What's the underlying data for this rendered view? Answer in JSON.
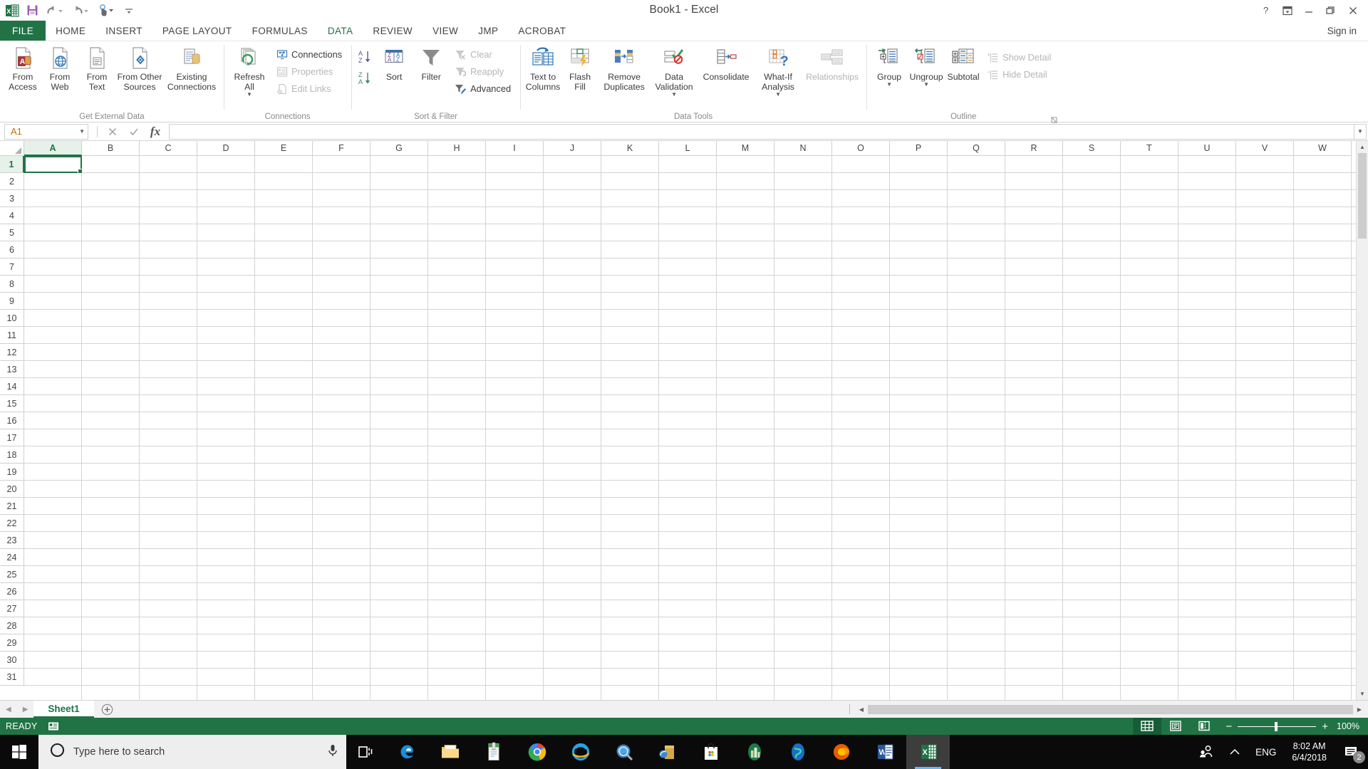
{
  "window": {
    "title": "Book1 - Excel",
    "help_label": "?",
    "ribbon_display_label": "ribbon-display-options",
    "minimize_label": "minimize",
    "restore_label": "restore",
    "close_label": "close",
    "signin_label": "Sign in"
  },
  "quick_access": {
    "items": [
      {
        "name": "excel-logo-icon",
        "label": "Excel"
      },
      {
        "name": "save-icon",
        "label": "Save"
      },
      {
        "name": "undo-icon",
        "label": "Undo"
      },
      {
        "name": "redo-icon",
        "label": "Redo"
      },
      {
        "name": "touch-mode-icon",
        "label": "Touch/Mouse Mode"
      },
      {
        "name": "customize-qat-icon",
        "label": "Customize Quick Access Toolbar"
      }
    ]
  },
  "ribbon": {
    "tabs": [
      {
        "label": "FILE",
        "id": "file",
        "active": false
      },
      {
        "label": "HOME",
        "id": "home",
        "active": false
      },
      {
        "label": "INSERT",
        "id": "insert",
        "active": false
      },
      {
        "label": "PAGE LAYOUT",
        "id": "page-layout",
        "active": false
      },
      {
        "label": "FORMULAS",
        "id": "formulas",
        "active": false
      },
      {
        "label": "DATA",
        "id": "data",
        "active": true
      },
      {
        "label": "REVIEW",
        "id": "review",
        "active": false
      },
      {
        "label": "VIEW",
        "id": "view",
        "active": false
      },
      {
        "label": "JMP",
        "id": "jmp",
        "active": false
      },
      {
        "label": "ACROBAT",
        "id": "acrobat",
        "active": false
      }
    ],
    "groups": {
      "get_external_data": {
        "label": "Get External Data",
        "buttons": [
          {
            "label": "From\nAccess",
            "name": "from-access-button"
          },
          {
            "label": "From\nWeb",
            "name": "from-web-button"
          },
          {
            "label": "From\nText",
            "name": "from-text-button"
          },
          {
            "label": "From Other\nSources",
            "name": "from-other-sources-button",
            "caret": true
          },
          {
            "label": "Existing\nConnections",
            "name": "existing-connections-button"
          }
        ]
      },
      "connections": {
        "label": "Connections",
        "refresh_all": "Refresh\nAll",
        "items": [
          {
            "label": "Connections",
            "name": "connections-button",
            "disabled": false
          },
          {
            "label": "Properties",
            "name": "properties-button",
            "disabled": true
          },
          {
            "label": "Edit Links",
            "name": "edit-links-button",
            "disabled": true
          }
        ]
      },
      "sort_filter": {
        "label": "Sort & Filter",
        "sort_asc": "Sort A to Z",
        "sort_desc": "Sort Z to A",
        "sort": "Sort",
        "filter": "Filter",
        "items": [
          {
            "label": "Clear",
            "name": "clear-button",
            "disabled": true
          },
          {
            "label": "Reapply",
            "name": "reapply-button",
            "disabled": true
          },
          {
            "label": "Advanced",
            "name": "advanced-button",
            "disabled": false
          }
        ]
      },
      "data_tools": {
        "label": "Data Tools",
        "buttons": [
          {
            "label": "Text to\nColumns",
            "name": "text-to-columns-button",
            "caret": false
          },
          {
            "label": "Flash\nFill",
            "name": "flash-fill-button",
            "caret": false
          },
          {
            "label": "Remove\nDuplicates",
            "name": "remove-duplicates-button",
            "caret": false
          },
          {
            "label": "Data\nValidation",
            "name": "data-validation-button",
            "caret": true
          },
          {
            "label": "Consolidate",
            "name": "consolidate-button",
            "caret": false
          },
          {
            "label": "What-If\nAnalysis",
            "name": "what-if-analysis-button",
            "caret": true
          },
          {
            "label": "Relationships",
            "name": "relationships-button",
            "caret": false,
            "disabled": true
          }
        ]
      },
      "outline": {
        "label": "Outline",
        "buttons": [
          {
            "label": "Group",
            "name": "group-button",
            "caret": true
          },
          {
            "label": "Ungroup",
            "name": "ungroup-button",
            "caret": true
          },
          {
            "label": "Subtotal",
            "name": "subtotal-button",
            "caret": false
          }
        ],
        "items": [
          {
            "label": "Show Detail",
            "name": "show-detail-button",
            "disabled": true
          },
          {
            "label": "Hide Detail",
            "name": "hide-detail-button",
            "disabled": true
          }
        ],
        "dialog_launcher": "outline-dialog-launcher"
      }
    }
  },
  "formula_bar": {
    "name_box_value": "A1",
    "cancel_label": "Cancel",
    "enter_label": "Enter",
    "fx_label": "Insert Function",
    "formula_value": "",
    "formula_placeholder": "",
    "expand_label": "Expand Formula Bar"
  },
  "grid": {
    "columns": [
      "A",
      "B",
      "C",
      "D",
      "E",
      "F",
      "G",
      "H",
      "I",
      "J",
      "K",
      "L",
      "M",
      "N",
      "O",
      "P",
      "Q",
      "R",
      "S",
      "T",
      "U",
      "V",
      "W"
    ],
    "rows": [
      1,
      2,
      3,
      4,
      5,
      6,
      7,
      8,
      9,
      10,
      11,
      12,
      13,
      14,
      15,
      16,
      17,
      18,
      19,
      20,
      21,
      22,
      23,
      24,
      25,
      26,
      27,
      28,
      29,
      30,
      31
    ],
    "active_cell": "A1",
    "selected_column": "A",
    "selected_row": 1
  },
  "sheet_bar": {
    "first_label": "First Sheet",
    "prev_label": "Previous Sheet",
    "next_label": "Next Sheet",
    "tabs": [
      {
        "label": "Sheet1",
        "active": true
      }
    ],
    "add_sheet_label": "New sheet"
  },
  "status_bar": {
    "state": "READY",
    "macro_record_label": "Record Macro",
    "views": [
      {
        "name": "normal-view-button",
        "label": "Normal",
        "active": true
      },
      {
        "name": "page-layout-view-button",
        "label": "Page Layout",
        "active": false
      },
      {
        "name": "page-break-preview-button",
        "label": "Page Break Preview",
        "active": false
      }
    ],
    "zoom_out_label": "−",
    "zoom_in_label": "+",
    "zoom_value": "100%"
  },
  "taskbar": {
    "start_label": "Start",
    "search_placeholder": "Type here to search",
    "cortana_label": "Cortana",
    "mic_label": "Microphone",
    "task_view_label": "Task View",
    "apps": [
      {
        "name": "taskbar-edge",
        "label": "Microsoft Edge",
        "active": false,
        "running": false
      },
      {
        "name": "taskbar-file-explorer",
        "label": "File Explorer",
        "active": false,
        "running": true
      },
      {
        "name": "taskbar-notepad",
        "label": "Notepad",
        "active": false,
        "running": false
      },
      {
        "name": "taskbar-chrome",
        "label": "Google Chrome",
        "active": false,
        "running": true
      },
      {
        "name": "taskbar-internet-explorer",
        "label": "Internet Explorer",
        "active": false,
        "running": false
      },
      {
        "name": "taskbar-search-app",
        "label": "Search",
        "active": false,
        "running": false
      },
      {
        "name": "taskbar-archive",
        "label": "Archive Utility",
        "active": false,
        "running": false
      },
      {
        "name": "taskbar-store",
        "label": "Microsoft Store",
        "active": false,
        "running": false
      },
      {
        "name": "taskbar-city-app",
        "label": "City App",
        "active": false,
        "running": false
      },
      {
        "name": "taskbar-globe-app",
        "label": "Globe App",
        "active": false,
        "running": false
      },
      {
        "name": "taskbar-firefox",
        "label": "Mozilla Firefox",
        "active": false,
        "running": false
      },
      {
        "name": "taskbar-word",
        "label": "Microsoft Word",
        "active": false,
        "running": true
      },
      {
        "name": "taskbar-excel",
        "label": "Microsoft Excel",
        "active": true,
        "running": true
      }
    ],
    "tray": {
      "people_label": "People",
      "show_hidden_label": "Show hidden icons",
      "language": "ENG",
      "time": "8:02 AM",
      "date": "6/4/2018",
      "notification_count": "2"
    }
  },
  "colors": {
    "excel_green": "#217346",
    "status_green": "#217346",
    "gridline": "#d4d4d4",
    "accent_blue": "#2e75b6"
  }
}
